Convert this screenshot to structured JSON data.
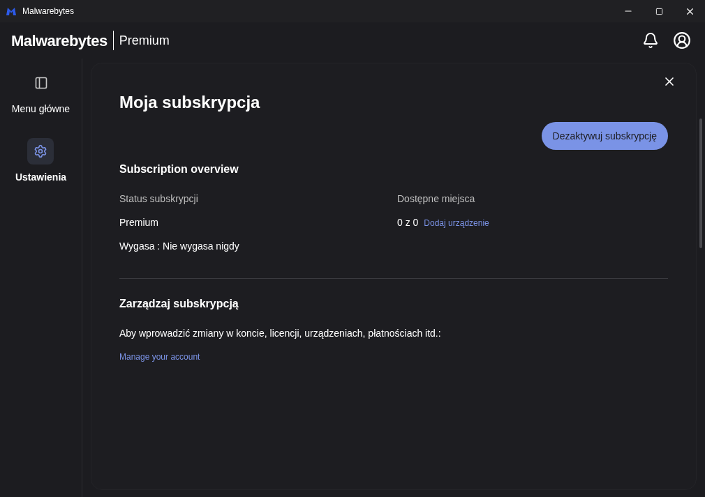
{
  "window": {
    "title": "Malwarebytes"
  },
  "header": {
    "brand": "Malwarebytes",
    "product": "Premium"
  },
  "sidebar": {
    "items": [
      {
        "label": "Menu główne",
        "kind": "home",
        "selected": false
      },
      {
        "label": "Ustawienia",
        "kind": "settings",
        "selected": true
      }
    ]
  },
  "panel": {
    "title": "Moja subskrypcja",
    "action_button": "Dezaktywuj subskrypcję",
    "overview": {
      "heading": "Subscription overview",
      "status_label": "Status subskrypcji",
      "status_value": "Premium",
      "expiry": "Wygasa : Nie wygasa nigdy",
      "seats_label": "Dostępne miejsca",
      "seats_value": "0 z 0",
      "seats_link": "Dodaj urządzenie"
    },
    "manage": {
      "heading": "Zarządzaj subskrypcją",
      "description": "Aby wprowadzić zmiany w koncie, licencji, urządzeniach, płatnościach itd.:",
      "link": "Manage your account"
    }
  }
}
